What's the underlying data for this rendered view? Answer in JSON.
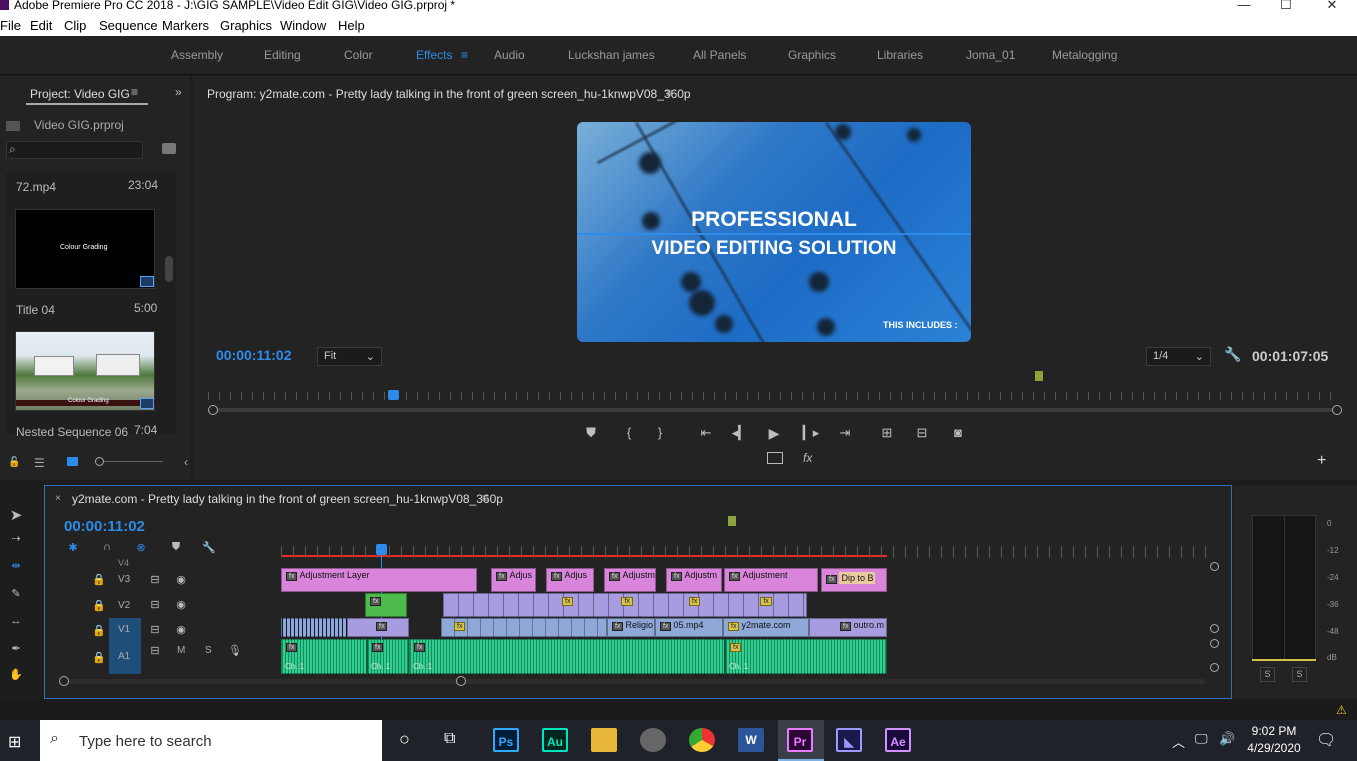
{
  "app": {
    "title": "Adobe Premiere Pro CC 2018 - J:\\GIG SAMPLE\\Video Edit GIG\\Video GIG.prproj *",
    "minimize": "—",
    "maximize": "☐",
    "close": "✕"
  },
  "menu": [
    "File",
    "Edit",
    "Clip",
    "Sequence",
    "Markers",
    "Graphics",
    "Window",
    "Help"
  ],
  "workspaces": [
    "Assembly",
    "Editing",
    "Color",
    "Effects",
    "Audio",
    "Luckshan james",
    "All Panels",
    "Graphics",
    "Libraries",
    "Joma_01",
    "Metalogging"
  ],
  "workspace_active": "Effects",
  "project": {
    "tab": "Project: Video GIG",
    "file": "Video GIG.prproj",
    "search_placeholder": "",
    "items": [
      {
        "name": "72.mp4",
        "duration": "23:04"
      },
      {
        "name": "Title 04",
        "duration": "5:00"
      },
      {
        "name": "Nested Sequence 06",
        "duration": "7:04"
      }
    ],
    "thumb1_text": "Colour Grading",
    "thumb2_text": "Colour Grading"
  },
  "program": {
    "tab": "Program: y2mate.com - Pretty lady talking in the front of green screen_hu-1knwpV08_360p",
    "timecode": "00:00:11:02",
    "zoom": "Fit",
    "resolution": "1/4",
    "duration": "00:01:07:05",
    "overlay_line1": "PROFESSIONAL",
    "overlay_line2": "VIDEO EDITING SOLUTION",
    "overlay_line3": "THIS INCLUDES :"
  },
  "timeline": {
    "tab": "y2mate.com - Pretty lady talking in the front of green screen_hu-1knwpV08_360p",
    "timecode": "00:00:11:02",
    "tracks": [
      {
        "label": "V4"
      },
      {
        "label": "V3"
      },
      {
        "label": "V2"
      },
      {
        "label": "V1"
      },
      {
        "label": "A1"
      }
    ],
    "audio_m": "M",
    "audio_s": "S",
    "clips": {
      "adj1": "Adjustment Layer",
      "adj2": "Adjus",
      "adj3": "Adjus",
      "adj4": "Adjustm",
      "adj5": "Adjustm",
      "adj6": "Adjustment",
      "dip": "Dip to B",
      "relig": "Religio",
      "mp4": "05.mp4",
      "y2": "y2mate.com",
      "outro": "outro.m",
      "ch1": "Ch. 1",
      "ch2": "Ch. 1",
      "ch3": "Ch. 1",
      "ch4": "Ch. 1"
    }
  },
  "meter": {
    "ticks": [
      "0",
      "-12",
      "-24",
      "-36",
      "-48",
      "dB"
    ],
    "solo_l": "S",
    "solo_r": "S"
  },
  "taskbar": {
    "search_placeholder": "Type here to search",
    "time": "9:02 PM",
    "date": "4/29/2020",
    "apps": [
      {
        "name": "Ps",
        "color": "#31a8ff",
        "bg": "#001e36"
      },
      {
        "name": "Au",
        "color": "#00e4bb",
        "bg": "#00261f"
      },
      {
        "name": "Pr",
        "color": "#e77bff",
        "bg": "#2a0634"
      },
      {
        "name": "Ae",
        "color": "#d291ff",
        "bg": "#1a0a3b"
      }
    ]
  },
  "colors": {
    "accent": "#2d8ceb",
    "adjustment": "#d985dc",
    "video": "#a79ce0",
    "audio": "#2ecf8f",
    "playhead_bar": "#e8291f"
  }
}
